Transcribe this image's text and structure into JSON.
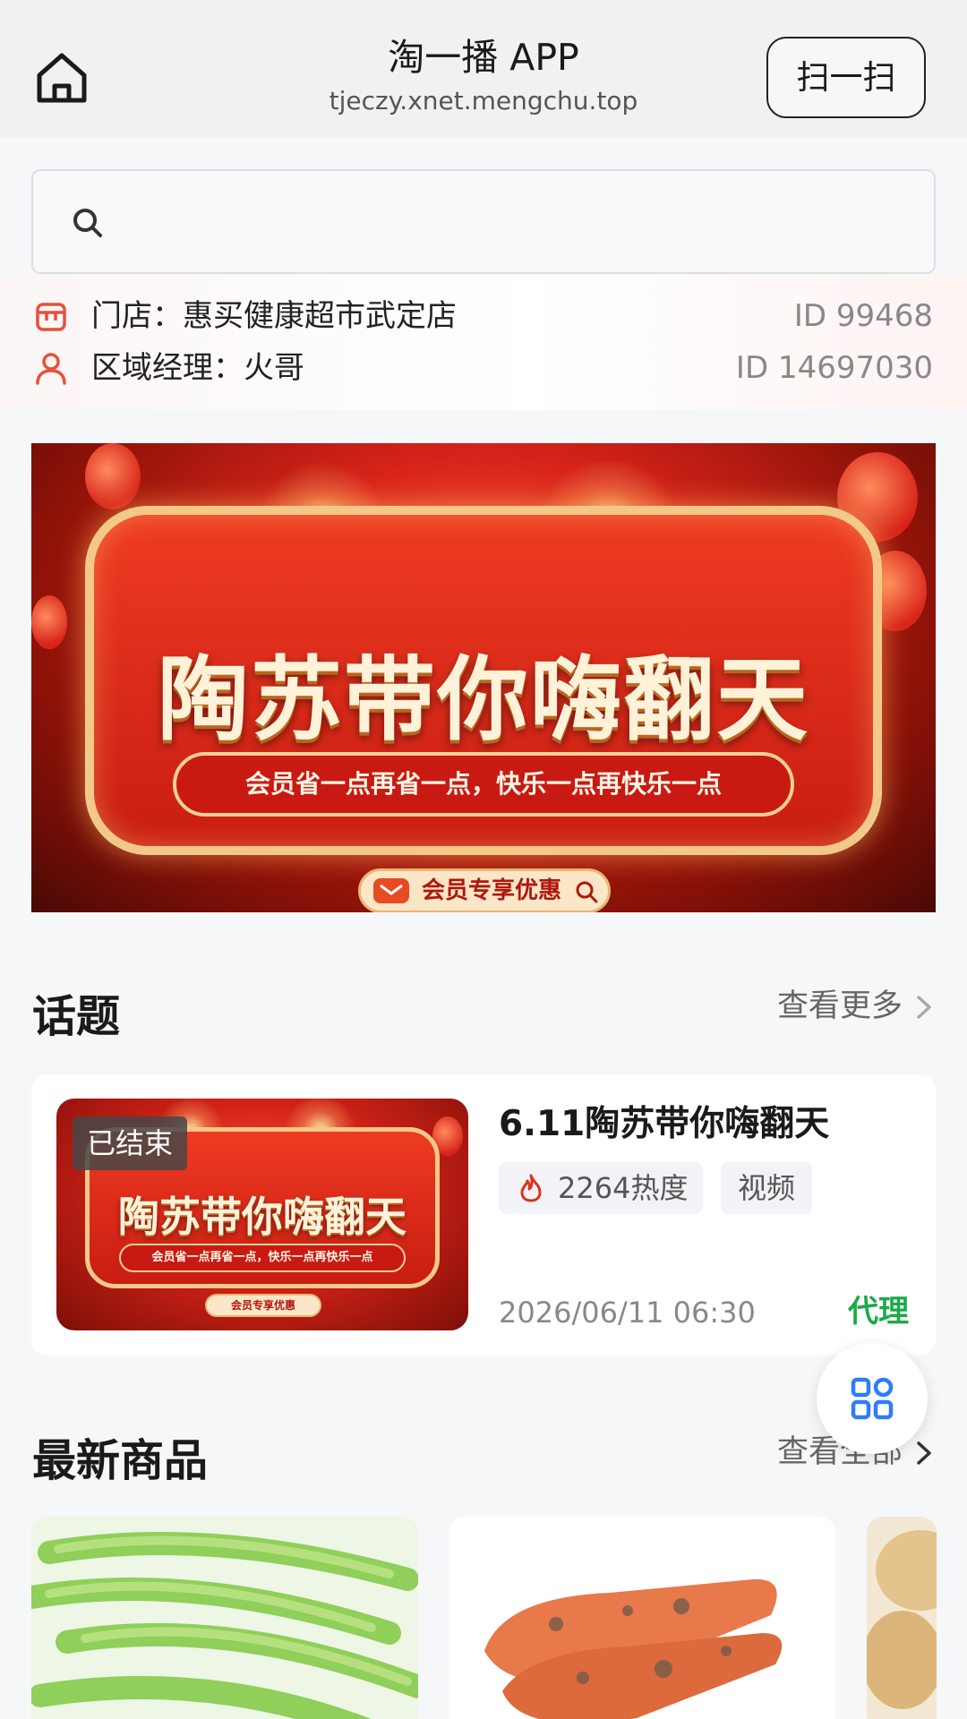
{
  "header": {
    "title": "淘一播 APP",
    "url": "tjeczy.xnet.mengchu.top",
    "scan_label": "扫一扫"
  },
  "search": {
    "placeholder": ""
  },
  "store": {
    "store_label": "门店：惠买健康超市武定店",
    "store_id": "ID 99468",
    "manager_label": "区域经理：火哥",
    "manager_id": "ID 14697030"
  },
  "banner": {
    "title": "陶苏带你嗨翻天",
    "slogan": "会员省一点再省一点，快乐一点再快乐一点",
    "cta": "会员专享优惠"
  },
  "topics": {
    "section_title": "话题",
    "more_label": "查看更多",
    "card": {
      "status_badge": "已结束",
      "name": "6.11陶苏带你嗨翻天",
      "heat": "2264热度",
      "type": "视频",
      "time": "2026/06/11 06:30",
      "agent": "代理",
      "thumb_title": "陶苏带你嗨翻天",
      "thumb_slogan": "会员省一点再省一点，快乐一点再快乐一点",
      "thumb_cta": "会员专享优惠"
    }
  },
  "products": {
    "section_title": "最新商品",
    "more_label": "查看全部",
    "items": [
      {
        "name": "green-beans"
      },
      {
        "name": "carrots"
      },
      {
        "name": "potatoes"
      }
    ]
  },
  "colors": {
    "accent_green": "#1aaa48",
    "banner_red": "#d7231a",
    "fire_red": "#e0301e",
    "grid_blue": "#2f7cf6"
  }
}
